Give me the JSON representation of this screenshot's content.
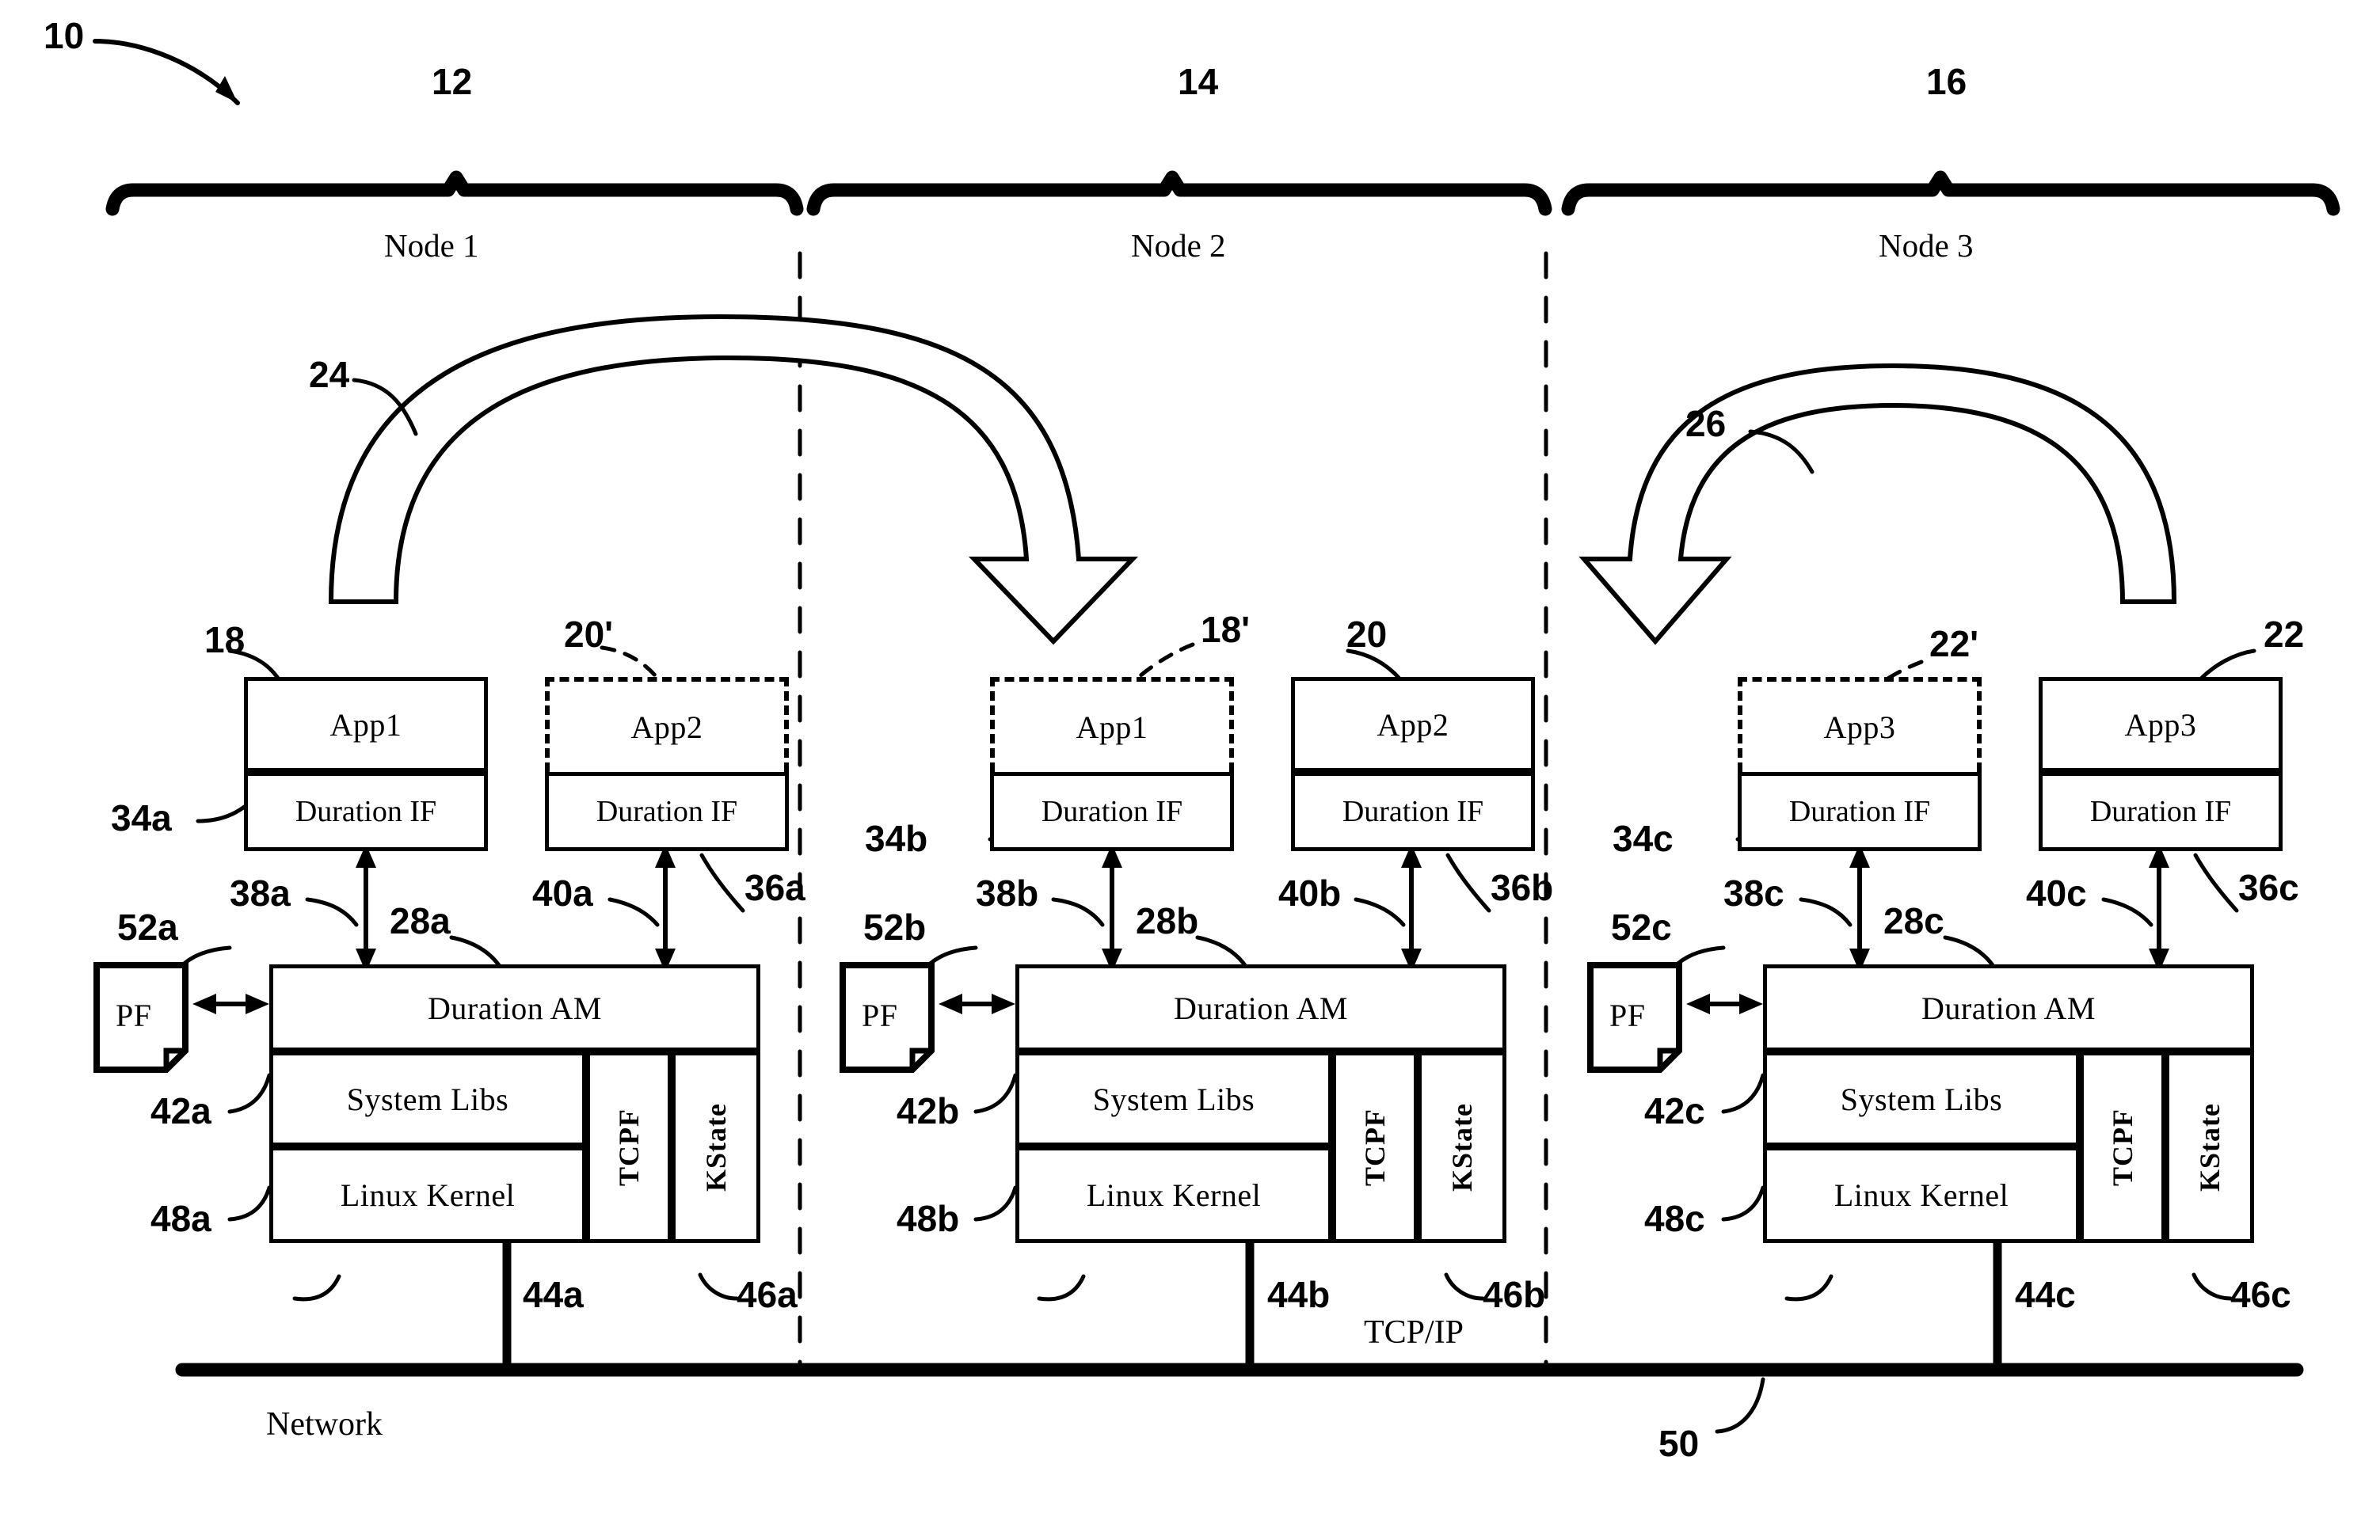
{
  "figure": {
    "figure_ref": "10",
    "network_label": "Network",
    "network_ref": "50",
    "protocol_label": "TCP/IP"
  },
  "nodes": [
    {
      "ref": "12",
      "title": "Node 1",
      "apps": [
        {
          "name": "App1",
          "ref": "18",
          "ghost": false,
          "if_label": "Duration  IF",
          "if_ref": "34a",
          "arrow_ref": "38a"
        },
        {
          "name": "App2",
          "ref": "20'",
          "ghost": true,
          "if_label": "Duration  IF",
          "if_ref": "36a",
          "arrow_ref": "40a"
        }
      ],
      "pf": {
        "label": "PF",
        "ref": "52a"
      },
      "am": {
        "label": "Duration AM",
        "ref": "28a"
      },
      "syslibs": {
        "label": "System Libs",
        "ref": "42a"
      },
      "kernel": {
        "label": "Linux Kernel",
        "ref": "48a"
      },
      "tcpf": {
        "label": "TCPF",
        "ref": "44a"
      },
      "kstate": {
        "label": "KState",
        "ref": "46a"
      }
    },
    {
      "ref": "14",
      "title": "Node 2",
      "apps": [
        {
          "name": "App1",
          "ref": "18'",
          "ghost": true,
          "if_label": "Duration  IF",
          "if_ref": "34b",
          "arrow_ref": "38b"
        },
        {
          "name": "App2",
          "ref": "20",
          "ghost": false,
          "if_label": "Duration  IF",
          "if_ref": "36b",
          "arrow_ref": "40b"
        }
      ],
      "pf": {
        "label": "PF",
        "ref": "52b"
      },
      "am": {
        "label": "Duration AM",
        "ref": "28b"
      },
      "syslibs": {
        "label": "System Libs",
        "ref": "42b"
      },
      "kernel": {
        "label": "Linux Kernel",
        "ref": "48b"
      },
      "tcpf": {
        "label": "TCPF",
        "ref": "44b"
      },
      "kstate": {
        "label": "KState",
        "ref": "46b"
      }
    },
    {
      "ref": "16",
      "title": "Node 3",
      "apps": [
        {
          "name": "App3",
          "ref": "22'",
          "ghost": true,
          "if_label": "Duration  IF",
          "if_ref": "34c",
          "arrow_ref": "38c"
        },
        {
          "name": "App3",
          "ref": "22",
          "ghost": false,
          "if_label": "Duration  IF",
          "if_ref": "36c",
          "arrow_ref": "40c"
        }
      ],
      "pf": {
        "label": "PF",
        "ref": "52c"
      },
      "am": {
        "label": "Duration AM",
        "ref": "28c"
      },
      "syslibs": {
        "label": "System Libs",
        "ref": "42c"
      },
      "kernel": {
        "label": "Linux Kernel",
        "ref": "48c"
      },
      "tcpf": {
        "label": "TCPF",
        "ref": "44c"
      },
      "kstate": {
        "label": "KState",
        "ref": "46c"
      }
    }
  ],
  "migration_arrows": [
    {
      "ref": "24",
      "from": "Node 1 App1",
      "to": "Node 2 App1"
    },
    {
      "ref": "26",
      "from": "Node 3 App3",
      "to": "Node 3 App3-ghost"
    }
  ]
}
